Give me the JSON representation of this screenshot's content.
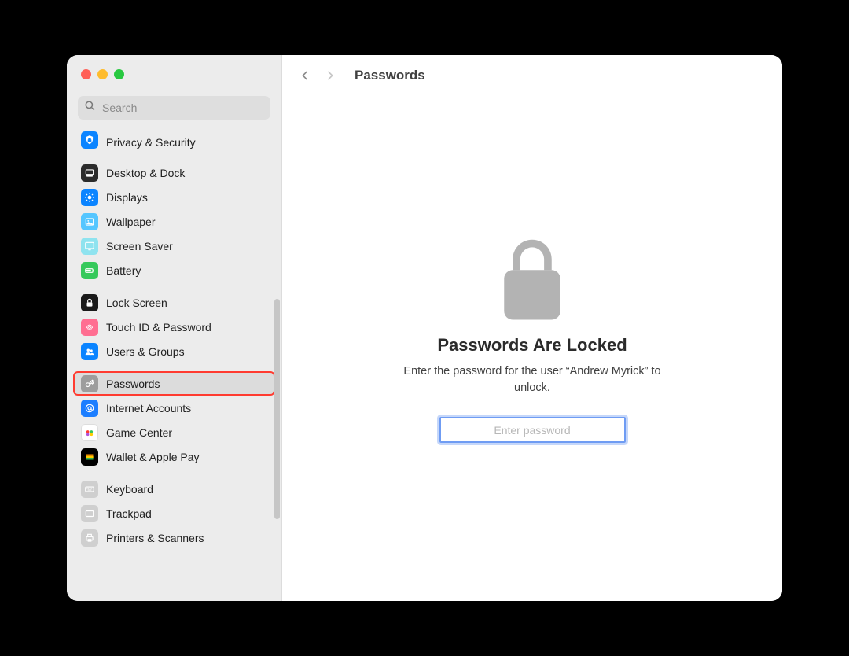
{
  "window": {
    "title": "Passwords"
  },
  "search": {
    "placeholder": "Search",
    "value": ""
  },
  "sidebar": {
    "groups": [
      {
        "items": [
          {
            "label": "Privacy & Security",
            "icon": "shield-icon",
            "color": "c-blue",
            "truncated": true
          },
          {
            "label": "",
            "icon": null,
            "color": null
          }
        ]
      },
      {
        "items": [
          {
            "label": "Desktop & Dock",
            "icon": "dock-icon",
            "color": "c-dark"
          },
          {
            "label": "Displays",
            "icon": "brightness-icon",
            "color": "c-blue"
          },
          {
            "label": "Wallpaper",
            "icon": "wallpaper-icon",
            "color": "c-sky"
          },
          {
            "label": "Screen Saver",
            "icon": "screensaver-icon",
            "color": "c-teal"
          },
          {
            "label": "Battery",
            "icon": "battery-icon",
            "color": "c-green"
          }
        ]
      },
      {
        "items": [
          {
            "label": "Lock Screen",
            "icon": "lockscreen-icon",
            "color": "c-black"
          },
          {
            "label": "Touch ID & Password",
            "icon": "touchid-icon",
            "color": "c-pink"
          },
          {
            "label": "Users & Groups",
            "icon": "people-icon",
            "color": "c-people"
          }
        ]
      },
      {
        "items": [
          {
            "label": "Passwords",
            "icon": "key-icon",
            "color": "c-gray",
            "selected": true
          },
          {
            "label": "Internet Accounts",
            "icon": "at-icon",
            "color": "c-at"
          },
          {
            "label": "Game Center",
            "icon": "gamectr-icon",
            "color": "c-white"
          },
          {
            "label": "Wallet & Apple Pay",
            "icon": "wallet-icon",
            "color": "c-orange"
          }
        ]
      },
      {
        "items": [
          {
            "label": "Keyboard",
            "icon": "keyboard-icon",
            "color": "c-lgray"
          },
          {
            "label": "Trackpad",
            "icon": "trackpad-icon",
            "color": "c-lgray"
          },
          {
            "label": "Printers & Scanners",
            "icon": "printer-icon",
            "color": "c-lgray"
          }
        ]
      }
    ]
  },
  "main": {
    "locked_title": "Passwords Are Locked",
    "locked_subtitle": "Enter the password for the user “Andrew Myrick” to unlock.",
    "password_placeholder": "Enter password",
    "password_value": ""
  }
}
